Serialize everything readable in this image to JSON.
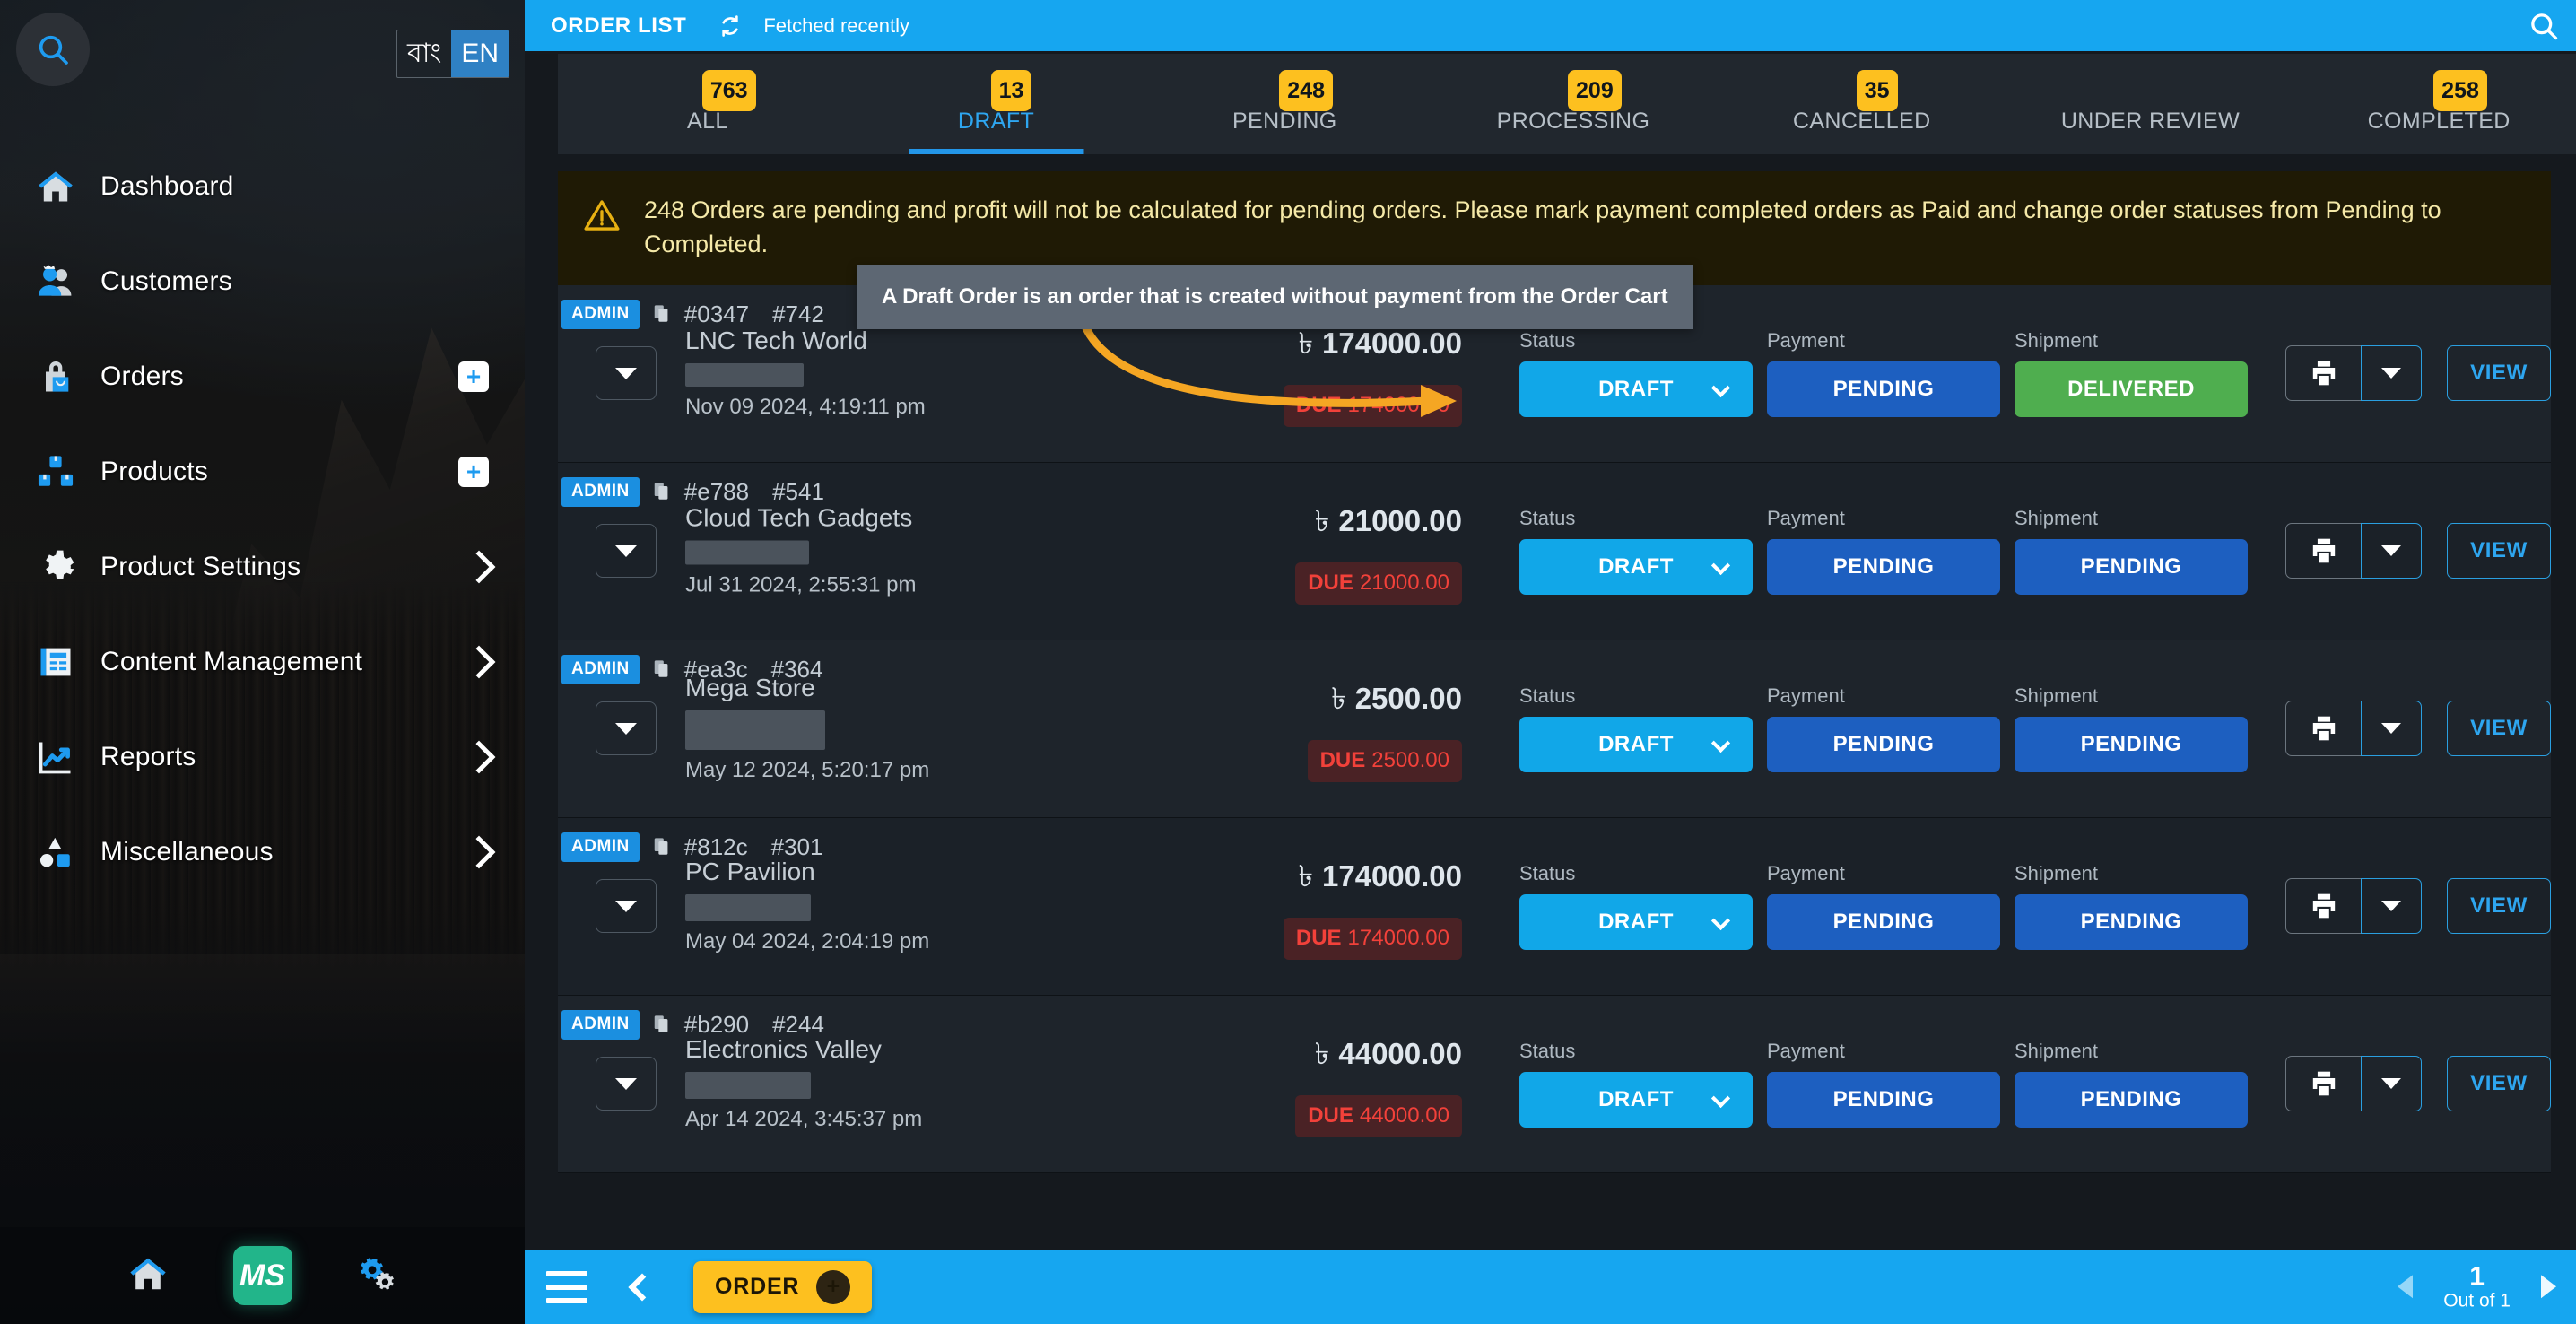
{
  "sidebar": {
    "search_icon": "search-icon",
    "language": {
      "bangla_label": "বাং",
      "english_label": "EN"
    },
    "items": [
      {
        "label": "Dashboard",
        "icon": "home-icon",
        "plus": false,
        "chevron": false
      },
      {
        "label": "Customers",
        "icon": "customers-icon",
        "plus": false,
        "chevron": false
      },
      {
        "label": "Orders",
        "icon": "bag-icon",
        "plus": true,
        "chevron": false
      },
      {
        "label": "Products",
        "icon": "boxes-icon",
        "plus": true,
        "chevron": false
      },
      {
        "label": "Product Settings",
        "icon": "gear-icon",
        "plus": false,
        "chevron": true
      },
      {
        "label": "Content Management",
        "icon": "content-icon",
        "plus": false,
        "chevron": true
      },
      {
        "label": "Reports",
        "icon": "chart-line-icon",
        "plus": false,
        "chevron": true
      },
      {
        "label": "Miscellaneous",
        "icon": "shapes-icon",
        "plus": false,
        "chevron": true
      }
    ],
    "bottom": {
      "home_icon": "home-icon",
      "logo_text": "MS",
      "settings_icon": "gears-icon"
    }
  },
  "topbar": {
    "title": "ORDER LIST",
    "refresh_icon": "refresh-icon",
    "status_text": "Fetched recently",
    "search_icon": "search-icon",
    "accent": "#16a6f0"
  },
  "tabs": [
    {
      "label": "ALL",
      "badge": "763",
      "active": false
    },
    {
      "label": "DRAFT",
      "badge": "13",
      "active": true
    },
    {
      "label": "PENDING",
      "badge": "248",
      "active": false
    },
    {
      "label": "PROCESSING",
      "badge": "209",
      "active": false
    },
    {
      "label": "CANCELLED",
      "badge": "35",
      "active": false
    },
    {
      "label": "UNDER REVIEW",
      "badge": "",
      "active": false
    },
    {
      "label": "COMPLETED",
      "badge": "258",
      "active": false
    }
  ],
  "alert": {
    "icon": "warning-triangle-icon",
    "text": "248 Orders are pending and profit will not be calculated for pending orders. Please mark payment completed orders as Paid and change order statuses from Pending to Completed."
  },
  "tooltip": {
    "text": "A Draft Order is an order that is created without payment from the Order Cart"
  },
  "labels": {
    "status": "Status",
    "payment": "Payment",
    "shipment": "Shipment",
    "admin_badge": "ADMIN",
    "view_button": "VIEW",
    "due_prefix": "DUE",
    "currency": "৳"
  },
  "orders": [
    {
      "source": "ADMIN",
      "order_id": "#0347",
      "order_no": "#742",
      "customer": "LNC Tech World",
      "date": "Nov 09 2024, 4:19:11 pm",
      "amount": "174000.00",
      "due": "174000.00",
      "status": "DRAFT",
      "payment": "PENDING",
      "shipment": "DELIVERED",
      "shipment_state": "delivered",
      "redact_w": 132,
      "redact_h": 26
    },
    {
      "source": "ADMIN",
      "order_id": "#e788",
      "order_no": "#541",
      "customer": "Cloud Tech Gadgets",
      "date": "Jul 31 2024, 2:55:31 pm",
      "amount": "21000.00",
      "due": "21000.00",
      "status": "DRAFT",
      "payment": "PENDING",
      "shipment": "PENDING",
      "shipment_state": "pending",
      "redact_w": 138,
      "redact_h": 27
    },
    {
      "source": "ADMIN",
      "order_id": "#ea3c",
      "order_no": "#364",
      "customer": "Mega Store",
      "date": "May 12 2024, 5:20:17 pm",
      "amount": "2500.00",
      "due": "2500.00",
      "status": "DRAFT",
      "payment": "PENDING",
      "shipment": "PENDING",
      "shipment_state": "pending",
      "redact_w": 156,
      "redact_h": 44
    },
    {
      "source": "ADMIN",
      "order_id": "#812c",
      "order_no": "#301",
      "customer": "PC Pavilion",
      "date": "May 04 2024, 2:04:19 pm",
      "amount": "174000.00",
      "due": "174000.00",
      "status": "DRAFT",
      "payment": "PENDING",
      "shipment": "PENDING",
      "shipment_state": "pending",
      "redact_w": 140,
      "redact_h": 30
    },
    {
      "source": "ADMIN",
      "order_id": "#b290",
      "order_no": "#244",
      "customer": "Electronics Valley",
      "date": "Apr 14 2024, 3:45:37 pm",
      "amount": "44000.00",
      "due": "44000.00",
      "status": "DRAFT",
      "payment": "PENDING",
      "shipment": "PENDING",
      "shipment_state": "pending",
      "redact_w": 140,
      "redact_h": 30
    }
  ],
  "footer": {
    "menu_icon": "hamburger-icon",
    "back_icon": "chevron-left-icon",
    "order_label": "ORDER",
    "order_plus_icon": "plus-circle-icon",
    "page_number": "1",
    "page_total": "Out of 1",
    "prev_icon": "triangle-left-icon",
    "next_icon": "triangle-right-icon"
  }
}
